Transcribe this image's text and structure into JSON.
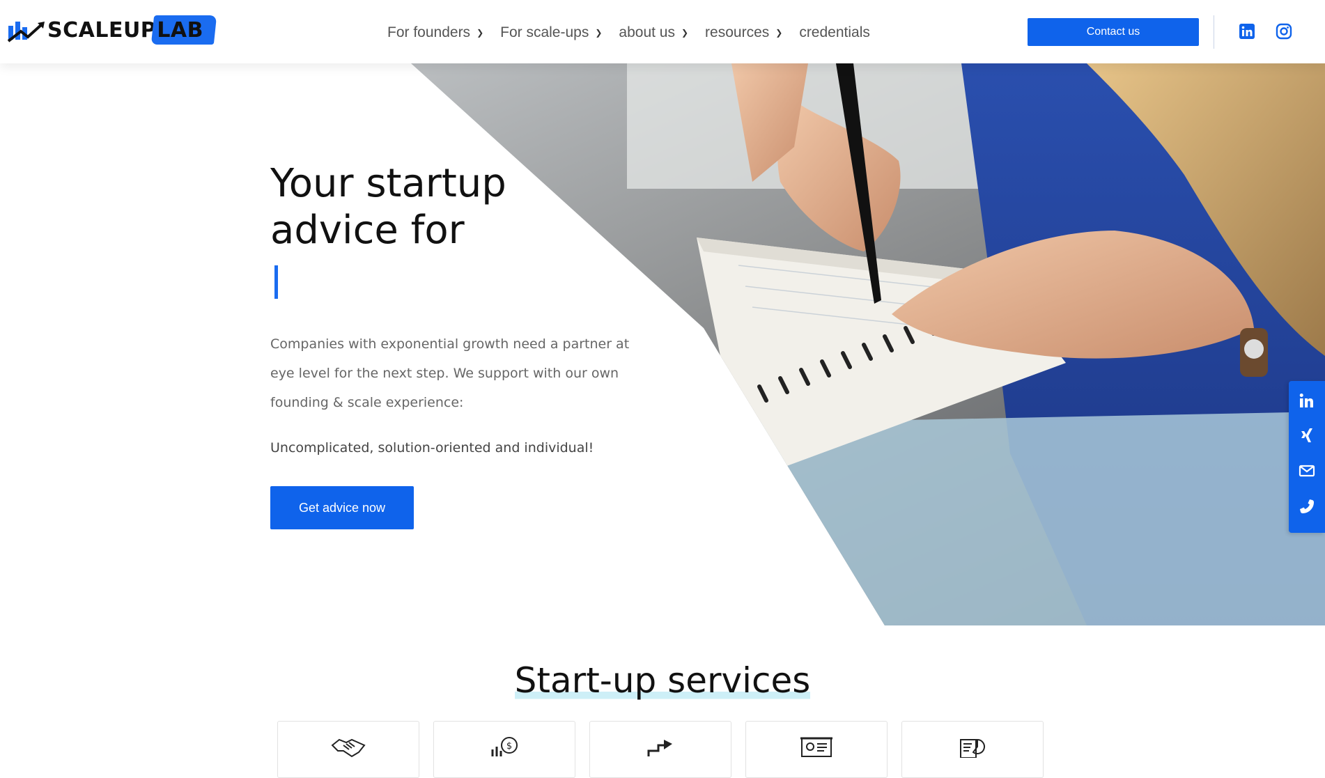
{
  "header": {
    "logo_part1": "SCALEUP",
    "logo_part2": "LAB",
    "nav": [
      {
        "label": "For founders",
        "has_dropdown": true
      },
      {
        "label": "For scale-ups",
        "has_dropdown": true
      },
      {
        "label": "about us",
        "has_dropdown": true
      },
      {
        "label": "resources",
        "has_dropdown": true
      },
      {
        "label": "credentials",
        "has_dropdown": false
      }
    ],
    "contact_label": "Contact us",
    "social_icons": [
      "linkedin-icon",
      "instagram-icon"
    ]
  },
  "hero": {
    "title_line1": "Your startup",
    "title_line2": "advice for",
    "description_line1": "Companies with exponential growth need a partner at",
    "description_line2": "eye level for the next step. We support with our own",
    "description_line3": "founding & scale experience:",
    "tagline": "Uncomplicated, solution-oriented and individual!",
    "cta_label": "Get advice now"
  },
  "side_bar": {
    "icons": [
      "linkedin-icon",
      "xing-icon",
      "mail-icon",
      "phone-icon"
    ]
  },
  "services": {
    "title": "Start-up services",
    "cards": [
      {
        "icon": "handshake-icon"
      },
      {
        "icon": "money-growth-icon"
      },
      {
        "icon": "rising-arrow-icon"
      },
      {
        "icon": "presentation-board-icon"
      },
      {
        "icon": "report-chart-icon"
      }
    ]
  },
  "colors": {
    "accent": "#0f63eb",
    "title_highlight": "#cdeff7",
    "text_muted": "#666666"
  }
}
